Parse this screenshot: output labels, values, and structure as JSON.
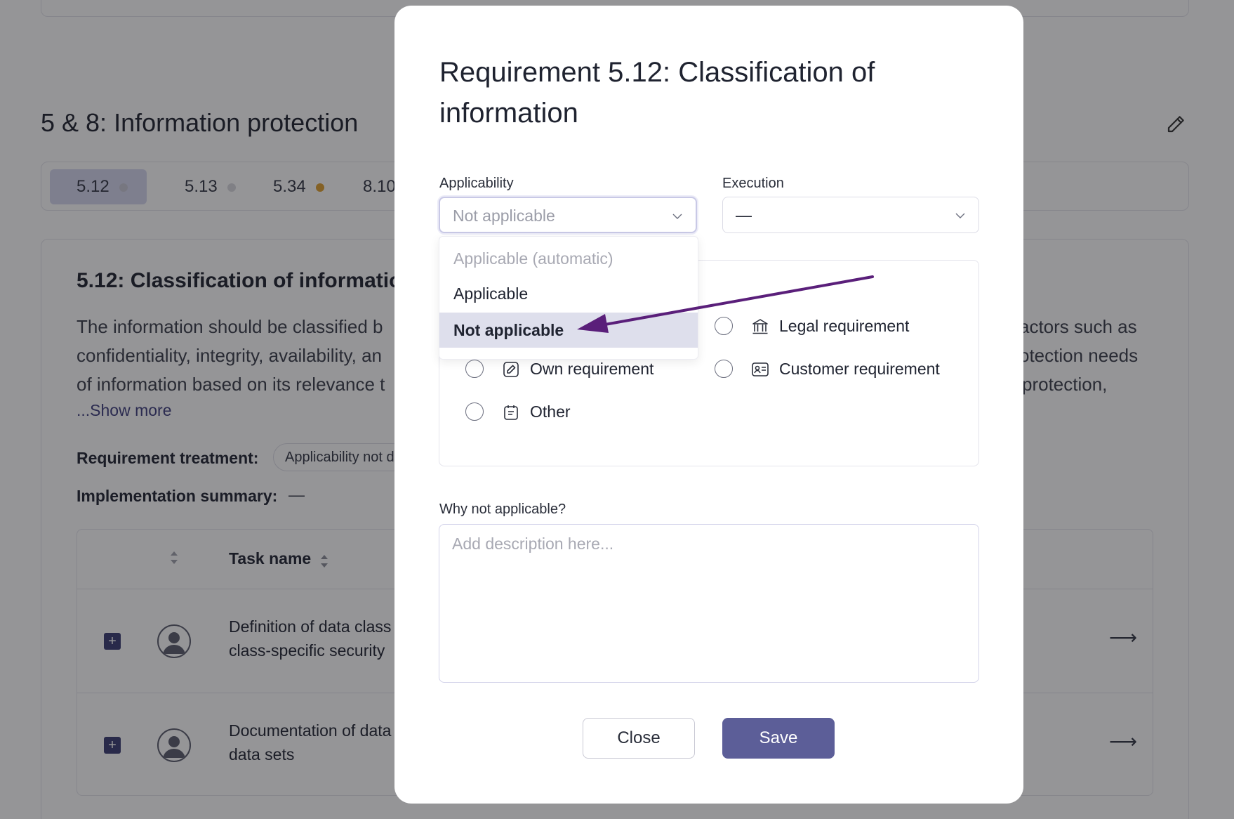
{
  "background": {
    "section_title": "5 & 8: Information protection",
    "tabs": [
      {
        "label": "5.12",
        "dot_color": "#c8c9d6"
      },
      {
        "label": "5.13",
        "dot_color": "#d9d9df"
      },
      {
        "label": "5.34",
        "dot_color": "#e0a030"
      },
      {
        "label": "8.10",
        "dot_color": "#d9d9df"
      }
    ],
    "requirement": {
      "title": "5.12: Classification of information",
      "description": "The information should be classified based on factors such as confidentiality, integrity, availability, and the protection needs of information based on its relevance to the organization and the level of protection,",
      "description_left_1": "The information should be classified b",
      "description_right_1": "actors such as",
      "description_left_2": "confidentiality, integrity, availability, an",
      "description_right_2": "otection needs",
      "description_left_3": "of information based on its relevance t",
      "description_right_3": "protection,",
      "show_more": "...Show more",
      "treatment_label": "Requirement treatment:",
      "treatment_value": "Applicability not d",
      "implementation_label": "Implementation summary:",
      "implementation_value": "—"
    },
    "table": {
      "column_task_name": "Task name",
      "rows": [
        {
          "line1": "Definition of data class",
          "line2": "class-specific security"
        },
        {
          "line1": "Documentation of data",
          "line2": "data sets"
        }
      ]
    }
  },
  "modal": {
    "title": "Requirement 5.12: Classification of information",
    "applicability": {
      "label": "Applicability",
      "value": "Not applicable",
      "options": [
        "Applicable (automatic)",
        "Applicable",
        "Not applicable"
      ],
      "selected": "Not applicable"
    },
    "execution": {
      "label": "Execution",
      "value": "—"
    },
    "sources": [
      {
        "label": "Legal requirement",
        "icon": "bank-icon"
      },
      {
        "label": "Own requirement",
        "icon": "edit-square-icon"
      },
      {
        "label": "Customer requirement",
        "icon": "id-card-icon"
      },
      {
        "label": "Other",
        "icon": "clipboard-icon"
      }
    ],
    "why_label": "Why not applicable?",
    "why_placeholder": "Add description here...",
    "close_label": "Close",
    "save_label": "Save"
  },
  "colors": {
    "accent": "#5c5e98",
    "annotation_arrow": "#5a1f7a"
  }
}
